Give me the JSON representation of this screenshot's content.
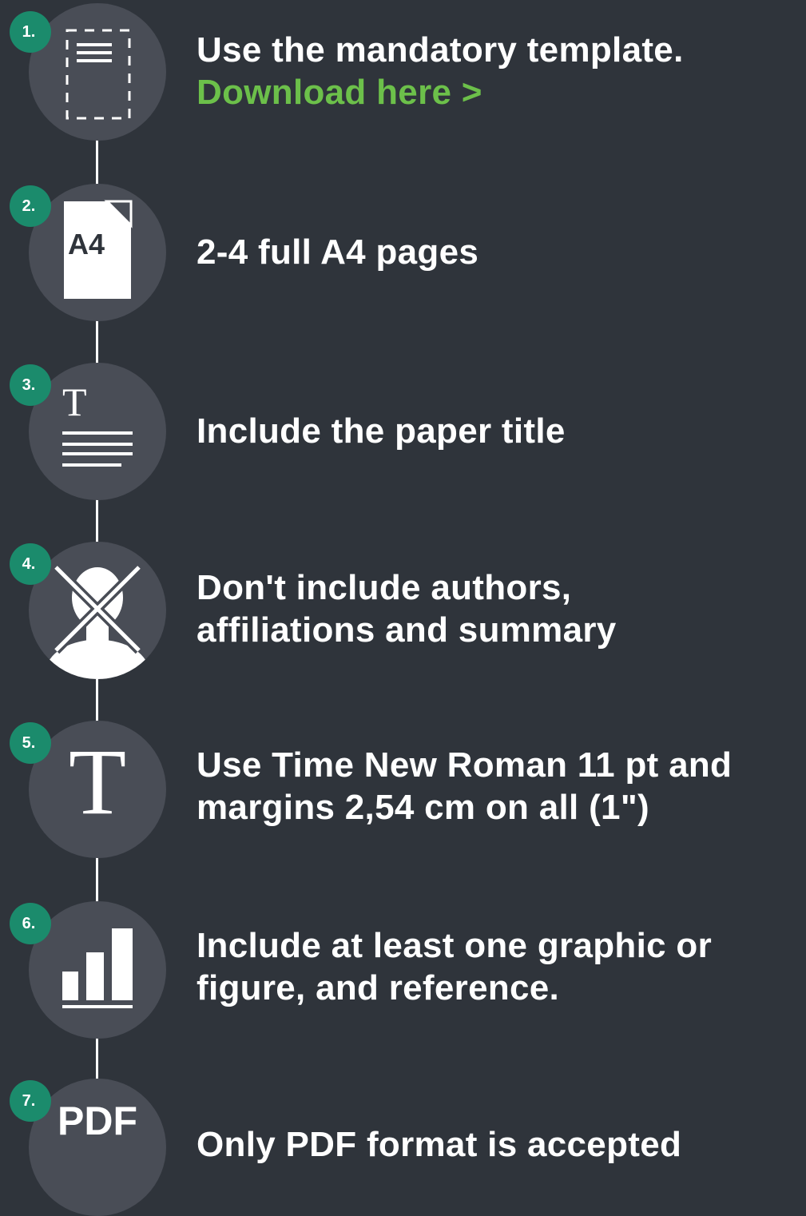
{
  "steps": [
    {
      "number": "1.",
      "icon": "document-template-icon",
      "lines": [
        "Use the mandatory template."
      ],
      "link": "Download here >"
    },
    {
      "number": "2.",
      "icon": "a4-page-icon",
      "icon_text": "A4",
      "lines": [
        "2-4 full A4 pages"
      ]
    },
    {
      "number": "3.",
      "icon": "title-text-icon",
      "icon_text": "T",
      "lines": [
        "Include the paper title"
      ]
    },
    {
      "number": "4.",
      "icon": "no-person-icon",
      "lines": [
        "Don't include authors,",
        "affiliations and summary"
      ]
    },
    {
      "number": "5.",
      "icon": "font-t-icon",
      "icon_text": "T",
      "lines": [
        "Use Time New Roman 11 pt and",
        "margins 2,54 cm on all (1\")"
      ]
    },
    {
      "number": "6.",
      "icon": "bar-chart-icon",
      "lines": [
        "Include at least one graphic or",
        "figure, and reference."
      ]
    },
    {
      "number": "7.",
      "icon": "pdf-icon",
      "icon_text": "PDF",
      "lines": [
        "Only PDF format is accepted"
      ]
    }
  ],
  "colors": {
    "background": "#2f343b",
    "circle": "#494d56",
    "badge": "#1b8b6c",
    "link": "#6cc04a",
    "text": "#ffffff"
  }
}
